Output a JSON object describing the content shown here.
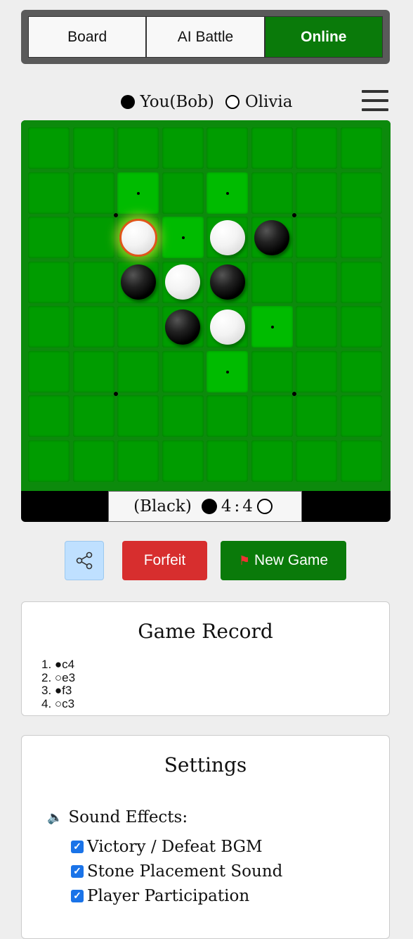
{
  "tabs": [
    "Board",
    "AI Battle",
    "Online"
  ],
  "active_tab": "Online",
  "players": {
    "black": "You(Bob)",
    "white": "Olivia"
  },
  "board": {
    "stones": [
      {
        "col": 2,
        "row": 2,
        "color": "white",
        "last": true
      },
      {
        "col": 4,
        "row": 2,
        "color": "white"
      },
      {
        "col": 5,
        "row": 2,
        "color": "black"
      },
      {
        "col": 2,
        "row": 3,
        "color": "black"
      },
      {
        "col": 3,
        "row": 3,
        "color": "white"
      },
      {
        "col": 4,
        "row": 3,
        "color": "black"
      },
      {
        "col": 3,
        "row": 4,
        "color": "black"
      },
      {
        "col": 4,
        "row": 4,
        "color": "white"
      }
    ],
    "legal_moves": [
      {
        "col": 2,
        "row": 1
      },
      {
        "col": 4,
        "row": 1
      },
      {
        "col": 3,
        "row": 2
      },
      {
        "col": 5,
        "row": 4
      },
      {
        "col": 4,
        "row": 5
      }
    ]
  },
  "score": {
    "label": "(Black)",
    "black": "4",
    "separator": ":",
    "white": "4"
  },
  "buttons": {
    "forfeit": "Forfeit",
    "new_game": "New Game"
  },
  "record": {
    "title": "Game Record",
    "moves": [
      "1. ●c4",
      "2. ○e3",
      "3. ●f3",
      "4. ○c3"
    ]
  },
  "settings": {
    "title": "Settings",
    "sound_label": "Sound Effects:",
    "options": [
      {
        "label": "Victory / Defeat BGM",
        "checked": true
      },
      {
        "label": "Stone Placement Sound",
        "checked": true
      },
      {
        "label": "Player Participation",
        "checked": true
      }
    ]
  },
  "colors": {
    "active_tab": "#0a7a0a",
    "board": "#009c00",
    "legal": "#00bb00",
    "forfeit": "#d72e2e",
    "new_game": "#0a7a0a"
  }
}
